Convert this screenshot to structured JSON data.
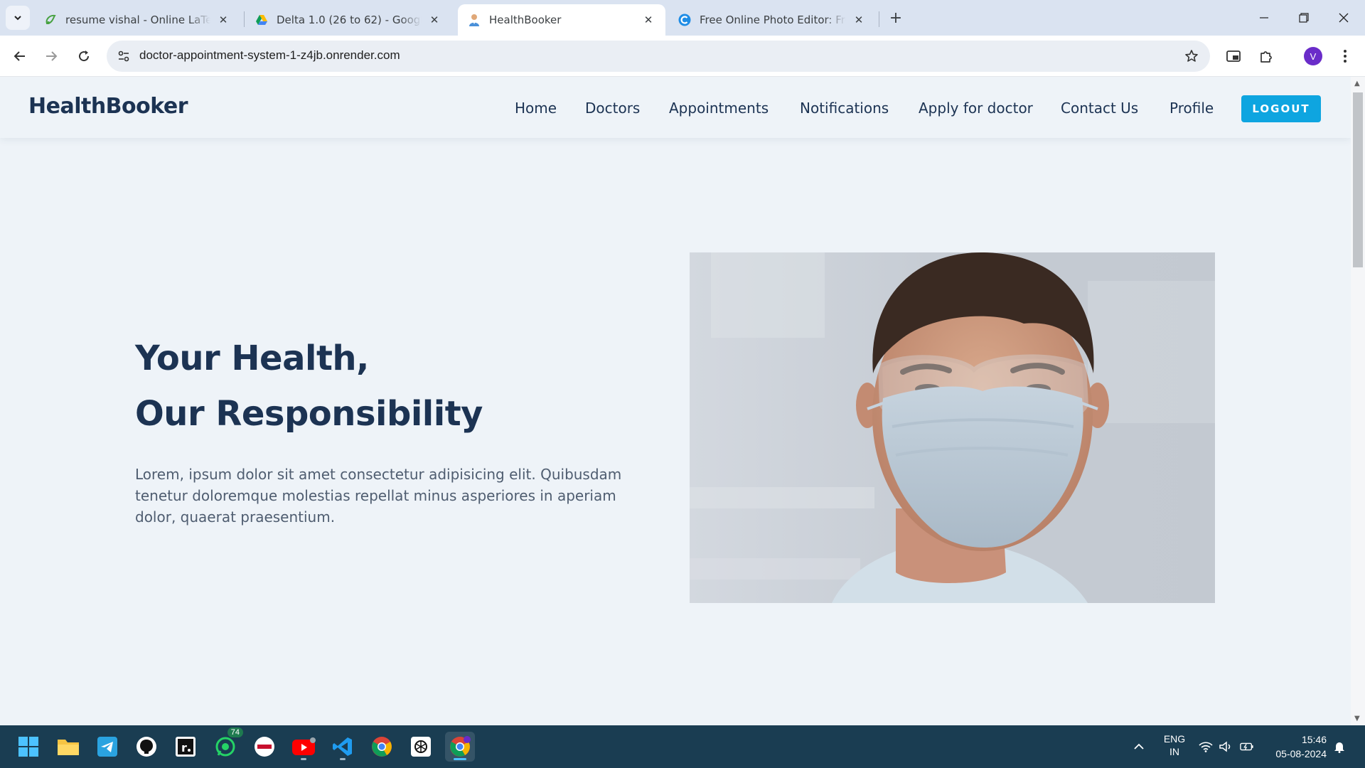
{
  "browser": {
    "tabs": [
      {
        "title": "resume vishal - Online LaTeX Ed",
        "favicon": "overleaf-icon"
      },
      {
        "title": "Delta 1.0 (26 to 62) - Google Dr",
        "favicon": "google-drive-icon"
      },
      {
        "title": "HealthBooker",
        "favicon": "doctor-icon",
        "active": true
      },
      {
        "title": "Free Online Photo Editor: Free &",
        "favicon": "photo-editor-icon"
      }
    ],
    "url": "doctor-appointment-system-1-z4jb.onrender.com",
    "profile_initial": "V"
  },
  "site": {
    "brand": "HealthBooker",
    "nav": [
      "Home",
      "Doctors",
      "Appointments",
      "Notifications",
      "Apply for doctor",
      "Contact Us",
      "Profile"
    ],
    "logout": "LOGOUT",
    "hero": {
      "line1": "Your Health,",
      "line2": "Our Responsibility",
      "text": "Lorem, ipsum dolor sit amet consectetur adipisicing elit. Quibusdam tenetur doloremque molestias repellat minus asperiores in aperiam dolor, quaerat praesentium.",
      "image": "doctor-wearing-mask-and-goggles"
    }
  },
  "colors": {
    "brand_navy": "#1c3353",
    "accent_blue": "#0ea5e0",
    "page_bg": "#eef3f8",
    "taskbar_bg": "#1a3d52"
  },
  "taskbar": {
    "apps": [
      "windows-start-icon",
      "file-explorer-icon",
      "telegram-icon",
      "github-icon",
      "notion-icon",
      "whatsapp-icon",
      "canon-icon",
      "youtube-icon",
      "vscode-icon",
      "chrome-icon",
      "chatgpt-icon",
      "chrome-profile-icon"
    ],
    "whatsapp_badge": "74",
    "lang_line1": "ENG",
    "lang_line2": "IN",
    "time": "15:46",
    "date": "05-08-2024"
  }
}
